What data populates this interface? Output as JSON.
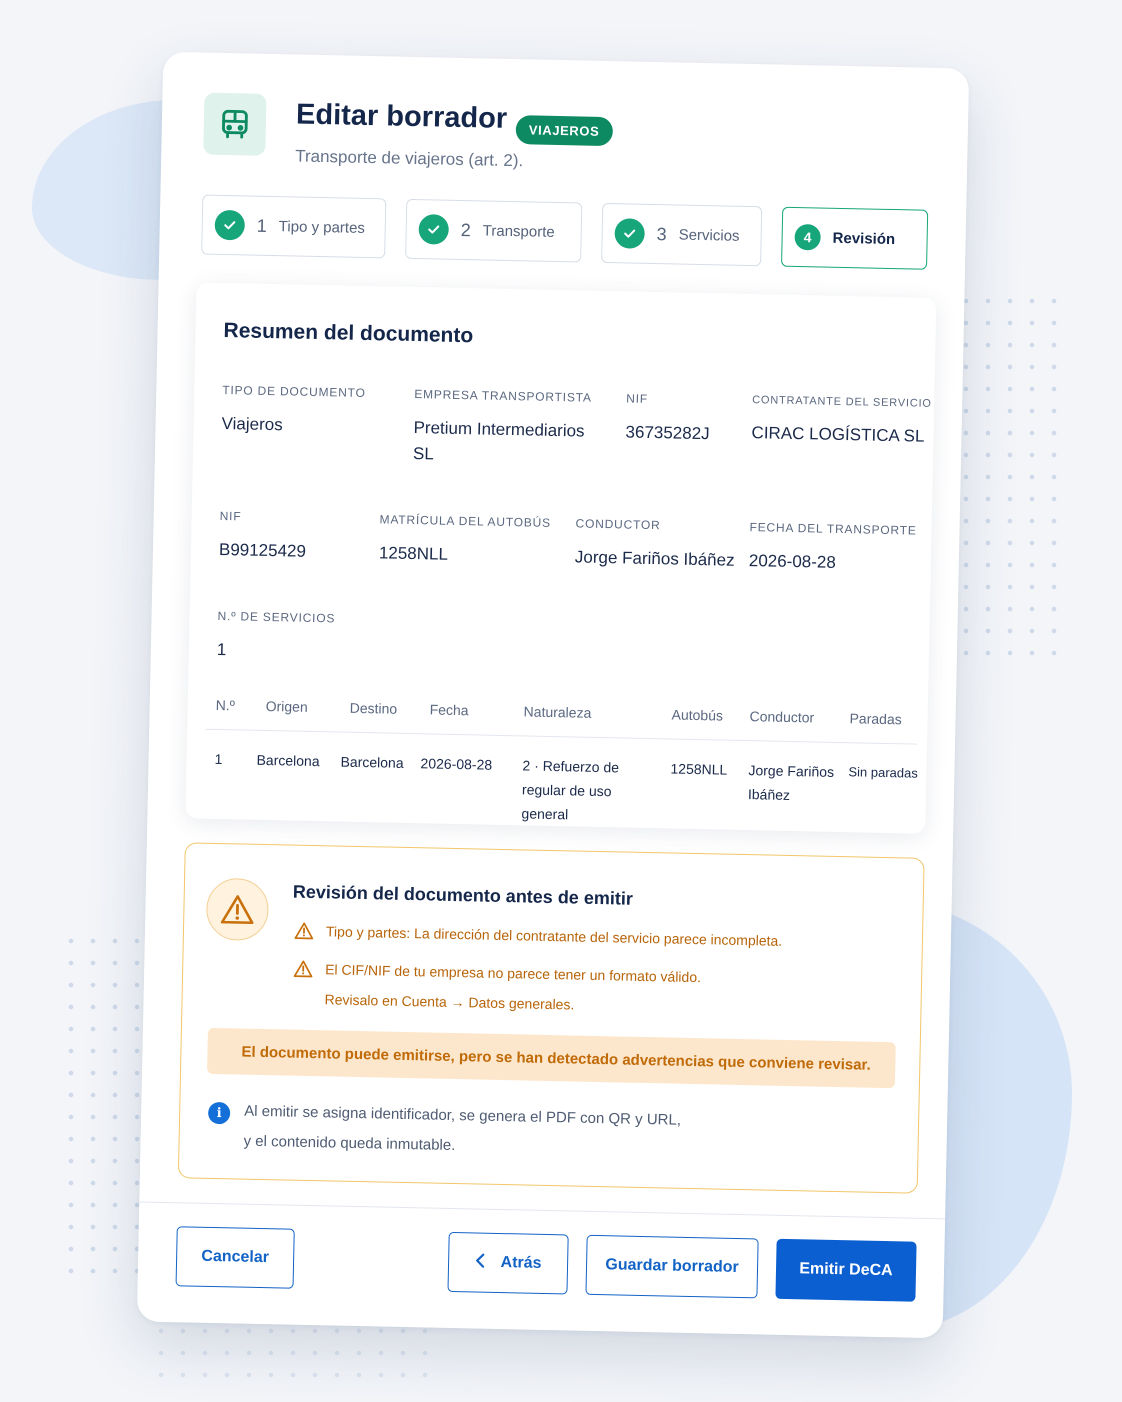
{
  "header": {
    "title": "Editar borrador",
    "badge": "VIAJEROS",
    "subtitle": "Transporte de viajeros (art. 2).",
    "icon": "bus-icon"
  },
  "steps": [
    {
      "num": "1",
      "label": "Tipo y partes",
      "state": "done"
    },
    {
      "num": "2",
      "label": "Transporte",
      "state": "done"
    },
    {
      "num": "3",
      "label": "Servicios",
      "state": "done"
    },
    {
      "num": "4",
      "label": "Revisión",
      "state": "active"
    }
  ],
  "summary": {
    "title": "Resumen del documento",
    "fields": {
      "tipo_documento": {
        "label": "Tipo de documento",
        "value": "Viajeros"
      },
      "empresa_transportista": {
        "label": "Empresa transportista",
        "value": "Pretium Intermediarios SL"
      },
      "nif_empresa": {
        "label": "NIF",
        "value": "36735282J"
      },
      "contratante": {
        "label": "Contratante del servicio",
        "value": "CIRAC LOGÍSTICA SL"
      },
      "nif_contratante": {
        "label": "NIF",
        "value": "B99125429"
      },
      "matricula": {
        "label": "Matrícula del autobús",
        "value": "1258NLL"
      },
      "conductor": {
        "label": "Conductor",
        "value": "Jorge Fariños Ibáñez"
      },
      "fecha": {
        "label": "Fecha del transporte",
        "value": "2026-08-28"
      },
      "n_servicios": {
        "label": "N.º de servicios",
        "value": "1"
      }
    },
    "table": {
      "headers": [
        "N.º",
        "Origen",
        "Destino",
        "Fecha",
        "Naturaleza",
        "Autobús",
        "Conductor",
        "Paradas"
      ],
      "rows": [
        [
          "1",
          "Barcelona",
          "Barcelona",
          "2026-08-28",
          "2 · Refuerzo de regular de uso general",
          "1258NLL",
          "Jorge Fariños Ibáñez",
          "Sin paradas"
        ]
      ]
    }
  },
  "review": {
    "title": "Revisión del documento antes de emitir",
    "warnings": [
      "Tipo y partes: La dirección del contratante del servicio parece incompleta.",
      "El CIF/NIF de tu empresa no parece tener un formato válido.",
      "Revisalo en Cuenta → Datos generales."
    ],
    "alert": "El documento puede emitirse, pero se han detectado advertencias que conviene revisar.",
    "info": [
      "Al emitir se asigna identificador, se genera el PDF con QR y URL,",
      "y el contenido queda inmutable."
    ],
    "info_glyph": "i"
  },
  "actions": {
    "cancel": "Cancelar",
    "back": "Atrás",
    "save": "Guardar borrador",
    "emit": "Emitir DeCA"
  },
  "colors": {
    "accent_green": "#17a57a",
    "primary_blue": "#0b5fd0",
    "warning_orange": "#b8650a"
  }
}
